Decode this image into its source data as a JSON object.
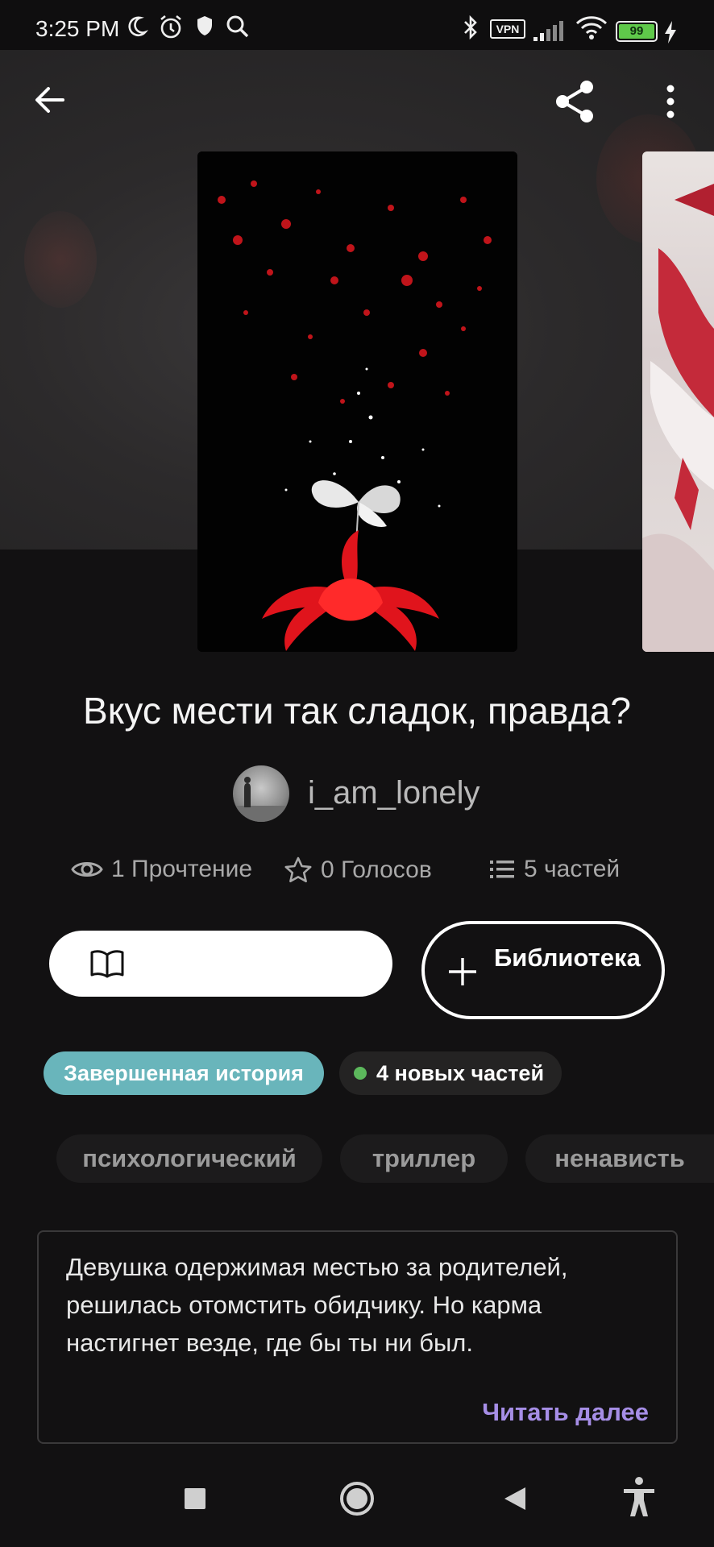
{
  "status_bar": {
    "time": "3:25 PM",
    "vpn_label": "VPN",
    "battery_level": "99",
    "icons": [
      "moon-icon",
      "alarm-icon",
      "shield-icon",
      "search-icon",
      "bluetooth-icon",
      "vpn-icon",
      "signal-icon",
      "wifi-icon",
      "battery-icon",
      "charging-icon"
    ]
  },
  "top_bar": {
    "icons": [
      "back-arrow-icon",
      "share-icon",
      "more-vert-icon"
    ]
  },
  "story": {
    "title": "Вкус мести так сладок, правда?",
    "author": "i_am_lonely",
    "stats": {
      "reads": "1 Прочтение",
      "votes": "0 Голосов",
      "parts": "5 частей"
    }
  },
  "actions": {
    "library_label": "Библиотека"
  },
  "badges": {
    "status": "Завершенная история",
    "new_parts": "4 новых частей"
  },
  "tags": [
    "психологический",
    "триллер",
    "ненависть"
  ],
  "description": {
    "text": "Девушка одержимая местью за родителей, решилась отомстить обидчику. Но карма настигнет везде, где бы ты ни был.",
    "read_more": "Читать далее"
  },
  "colors": {
    "background": "#121112",
    "complete_badge": "#69b5bb",
    "new_dot": "#5cb85c",
    "read_more": "#a68ee6"
  },
  "nav_bar": {
    "icons": [
      "recents-square-icon",
      "home-circle-icon",
      "back-triangle-icon",
      "accessibility-icon"
    ]
  }
}
